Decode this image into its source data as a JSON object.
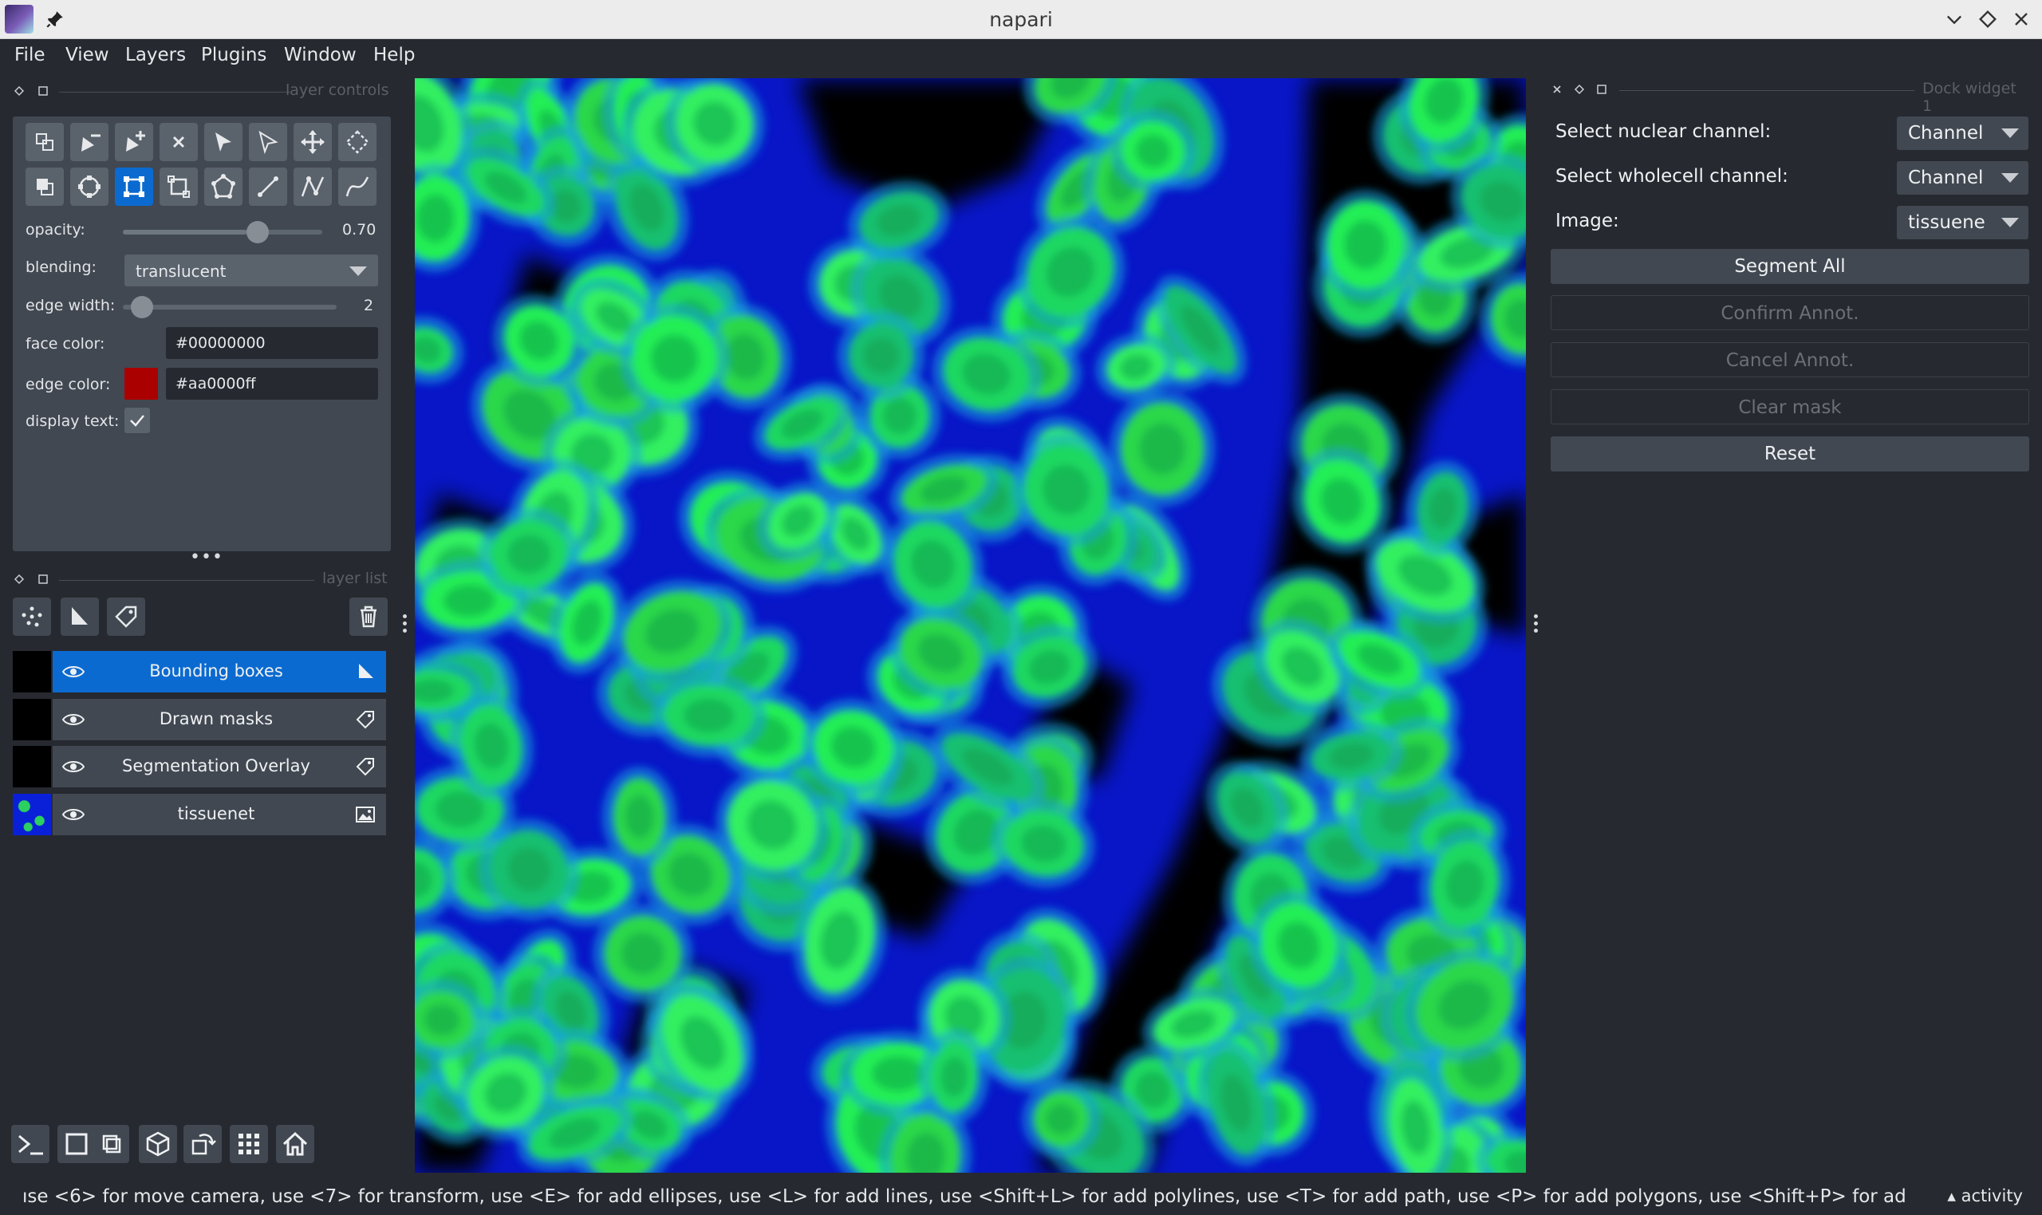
{
  "window": {
    "title": "napari"
  },
  "menu": [
    "File",
    "View",
    "Layers",
    "Plugins",
    "Window",
    "Help"
  ],
  "layer_controls": {
    "header_title": "layer controls",
    "opacity_label": "opacity:",
    "opacity_value": "0.70",
    "opacity_fraction": 0.7,
    "blending_label": "blending:",
    "blending_value": "translucent",
    "edge_width_label": "edge width:",
    "edge_width_value": "2",
    "edge_width_fraction": 0.04,
    "face_color_label": "face color:",
    "face_color_value": "#00000000",
    "edge_color_label": "edge color:",
    "edge_color_value": "#aa0000ff",
    "edge_color_swatch": "#aa0000",
    "display_text_label": "display text:",
    "display_text_checked": true,
    "tools_row1": [
      "insert-vertex-icon",
      "remove-vertex-icon",
      "add-vertex-icon",
      "delete-shape-icon",
      "select-icon",
      "direct-select-icon",
      "pan-zoom-icon",
      "lasso-select-icon"
    ],
    "tools_row2": [
      "move-back-icon",
      "ellipse-icon",
      "rectangle-icon",
      "transform-icon",
      "polygon-icon",
      "line-icon",
      "polyline-icon",
      "path-icon"
    ],
    "active_tool": "rectangle-icon"
  },
  "layer_list": {
    "header_title": "layer list",
    "layers": [
      {
        "name": "Bounding boxes",
        "type_icon": "shapes-icon",
        "selected": true
      },
      {
        "name": "Drawn masks",
        "type_icon": "labels-icon",
        "selected": false
      },
      {
        "name": "Segmentation Overlay",
        "type_icon": "labels-icon",
        "selected": false
      },
      {
        "name": "tissuenet",
        "type_icon": "image-icon",
        "selected": false
      }
    ]
  },
  "dock_widget": {
    "header_title": "Dock widget 1",
    "nuclear_label": "Select nuclear channel:",
    "nuclear_value": "Channel",
    "wholecell_label": "Select wholecell channel:",
    "wholecell_value": "Channel",
    "image_label": "Image:",
    "image_value": "tissuene",
    "buttons": [
      {
        "label": "Segment All",
        "enabled": true
      },
      {
        "label": "Confirm Annot.",
        "enabled": false
      },
      {
        "label": "Cancel Annot.",
        "enabled": false
      },
      {
        "label": "Clear mask",
        "enabled": false
      },
      {
        "label": "Reset",
        "enabled": true
      }
    ]
  },
  "status": {
    "text": "ıse <6> for move camera, use <7> for transform, use <E> for add ellipses, use <L> for add lines, use <Shift+L> for add polylines, use <T> for add path, use <P> for add polygons, use <Shift+P> for add polygons lasso, use <...",
    "activity": "activity"
  },
  "colors": {
    "background": "#262930",
    "panel": "#414851",
    "accent": "#0b6ad0",
    "canvas_nuclei": "#22ee55",
    "canvas_cytoplasm": "#0a1aff"
  }
}
